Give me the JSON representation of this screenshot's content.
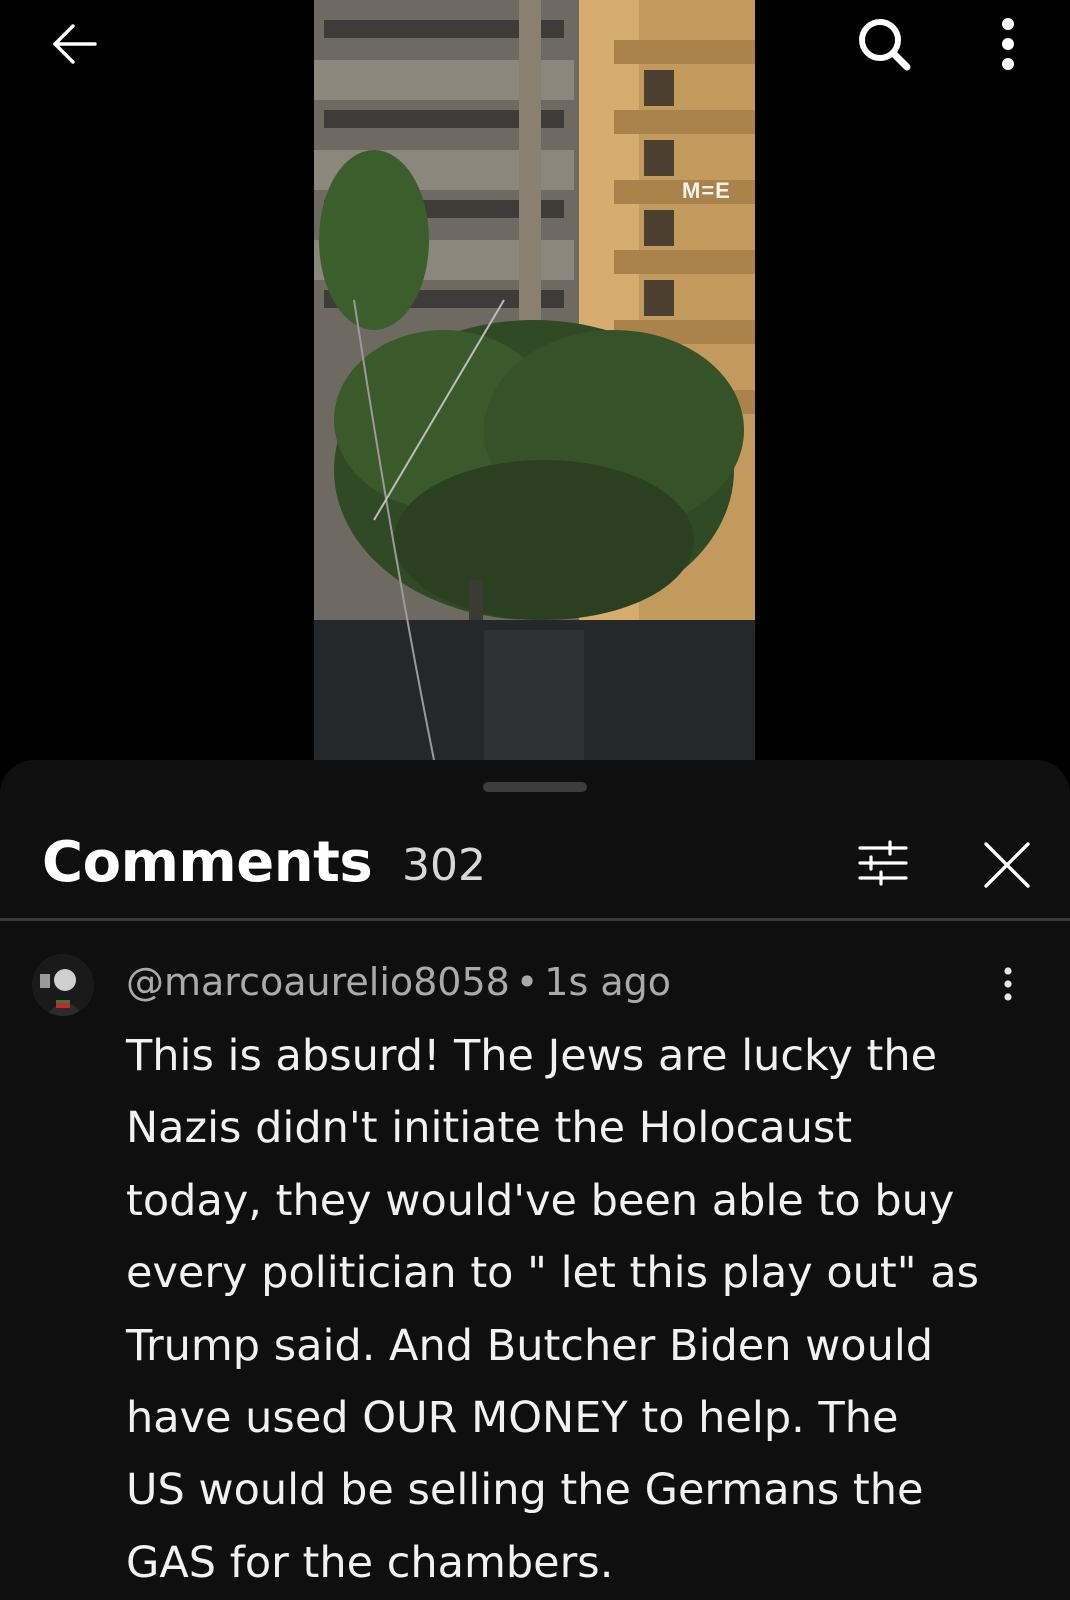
{
  "video": {
    "watermark": "M=E"
  },
  "top_bar": {
    "back_icon": "arrow-left-icon",
    "search_icon": "search-icon",
    "more_icon": "more-vertical-icon"
  },
  "comments": {
    "title": "Comments",
    "count": "302",
    "filter_icon": "sliders-icon",
    "close_icon": "close-icon",
    "items": [
      {
        "author": "@marcoaurelio8058",
        "separator": "•",
        "time": "1s ago",
        "text": "This is absurd! The Jews are lucky the\nNazis didn't initiate the Holocaust\ntoday, they would've been able to buy\nevery politician to \" let this play out\" as\nTrump said. And Butcher Biden would\nhave used OUR MONEY to help.  The\nUS would be selling the Germans the\nGAS for the chambers."
      }
    ]
  },
  "colors": {
    "sheet_bg": "#0f0f0f",
    "meta_text": "#aaaaaa",
    "divider": "#3a3a3a"
  }
}
